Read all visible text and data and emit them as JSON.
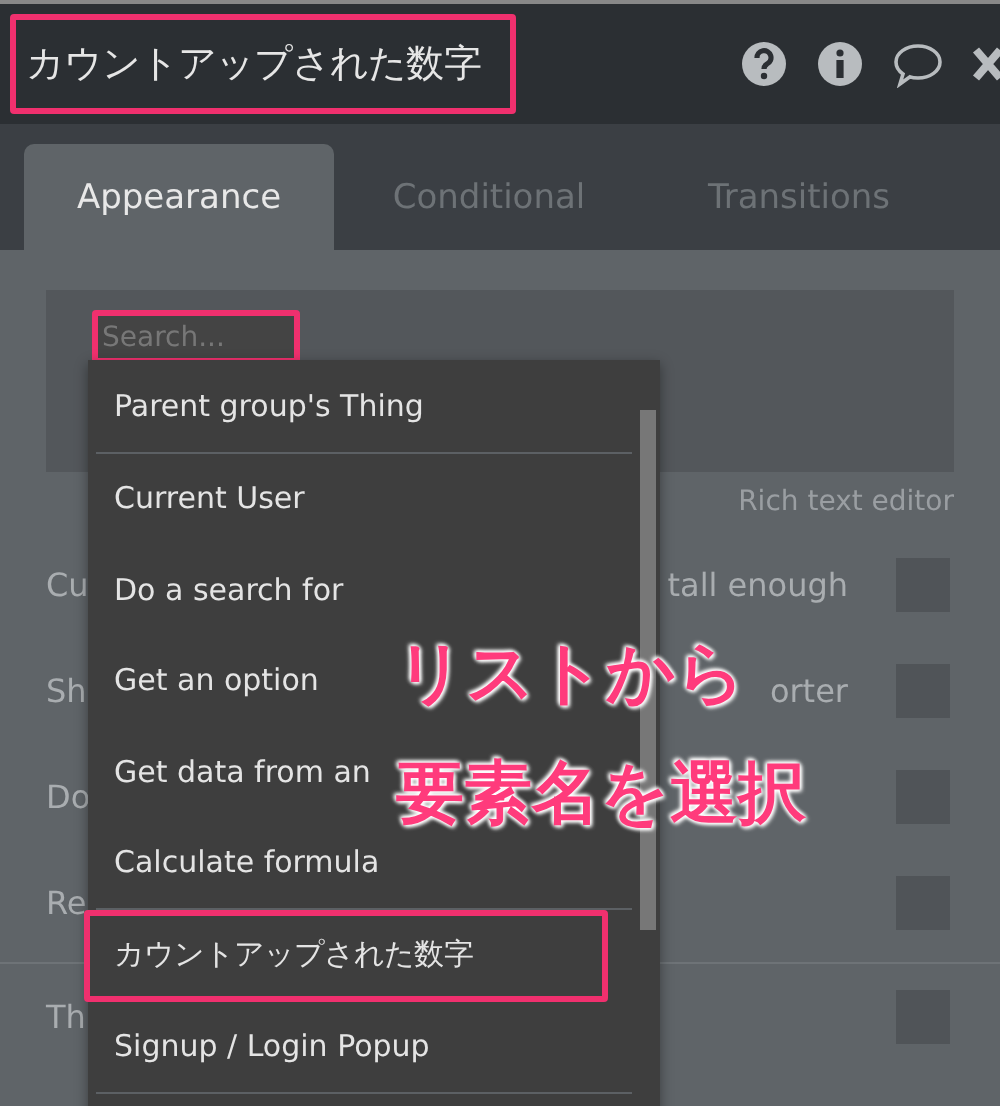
{
  "window": {
    "title": "カウントアップされた数字",
    "title_highlighted": true
  },
  "tabs": [
    {
      "label": "Appearance",
      "selected": true
    },
    {
      "label": "Conditional",
      "selected": false
    },
    {
      "label": "Transitions",
      "selected": false
    }
  ],
  "search": {
    "placeholder": "Search...",
    "highlighted": true
  },
  "editor_link": "Rich text editor",
  "options": [
    {
      "kind": "checkbox",
      "left": "Cu",
      "right": "tall enough",
      "checked": false
    },
    {
      "kind": "checkbox",
      "left": "Sh",
      "right": "orter",
      "checked": false
    },
    {
      "kind": "checkbox",
      "left": "Do",
      "checked": false
    },
    {
      "kind": "checkbox",
      "left": "Re",
      "checked": false
    },
    {
      "kind": "divider"
    },
    {
      "kind": "checkbox",
      "left": "Th",
      "checked": false
    }
  ],
  "dropdown": {
    "items": [
      {
        "kind": "entry",
        "label": "Parent group's Thing",
        "highlighted": false
      },
      {
        "kind": "divider"
      },
      {
        "kind": "entry",
        "label": "Current User",
        "highlighted": false
      },
      {
        "kind": "entry",
        "label": "Do a search for",
        "highlighted": false
      },
      {
        "kind": "entry",
        "label": "Get an option",
        "highlighted": false
      },
      {
        "kind": "entry",
        "label": "Get data from an",
        "highlighted": false
      },
      {
        "kind": "entry",
        "label": "Calculate formula",
        "highlighted": false
      },
      {
        "kind": "divider"
      },
      {
        "kind": "entry",
        "label": "カウントアップされた数字",
        "highlighted": true
      },
      {
        "kind": "entry",
        "label": "Signup / Login Popup",
        "highlighted": false
      },
      {
        "kind": "divider"
      }
    ]
  },
  "annotation": [
    "リストから",
    "要素名を選択"
  ]
}
